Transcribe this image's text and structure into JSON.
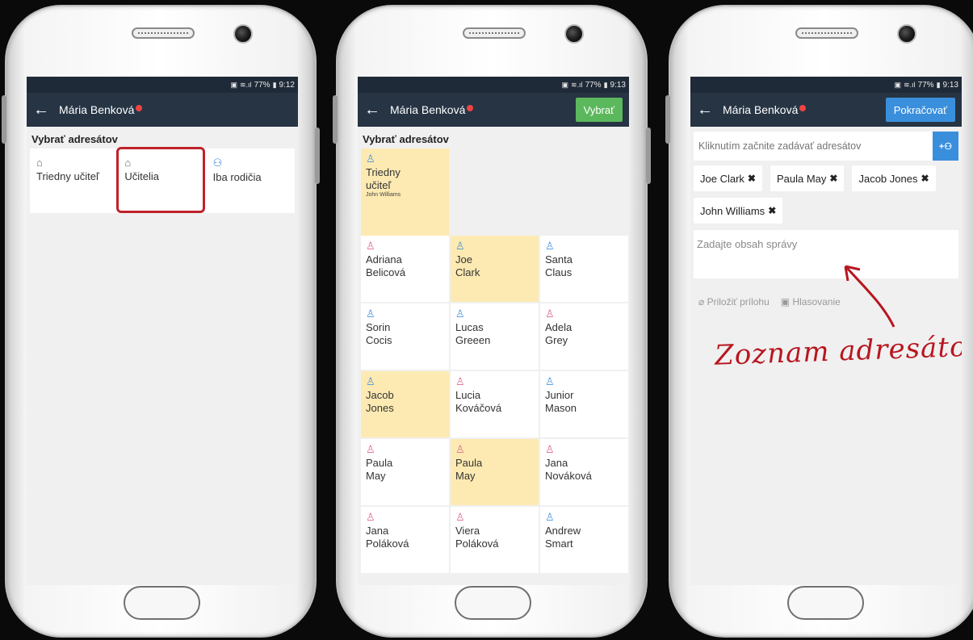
{
  "phone1": {
    "status": {
      "battery": "77%",
      "time": "9:12"
    },
    "header": {
      "title": "Mária Benková"
    },
    "section_title": "Vybrať adresátov",
    "groups": [
      {
        "label": "Triedny učiteľ",
        "icon": "school-icon"
      },
      {
        "label": "Učitelia",
        "icon": "school-icon"
      },
      {
        "label": "Iba rodičia",
        "icon": "parents-icon"
      }
    ]
  },
  "phone2": {
    "status": {
      "battery": "77%",
      "time": "9:13"
    },
    "header": {
      "title": "Mária Benková",
      "action": "Vybrať"
    },
    "section_title": "Vybrať adresátov",
    "first": {
      "line1": "Triedny",
      "line2": "učiteľ",
      "sub": "John Williams",
      "selected": true
    },
    "people": [
      {
        "first": "Adriana",
        "last": "Belicová",
        "gender": "female",
        "selected": false
      },
      {
        "first": "Joe",
        "last": "Clark",
        "gender": "male",
        "selected": true
      },
      {
        "first": "Santa",
        "last": "Claus",
        "gender": "male",
        "selected": false
      },
      {
        "first": "Sorin",
        "last": "Cocis",
        "gender": "male",
        "selected": false
      },
      {
        "first": "Lucas",
        "last": "Greeen",
        "gender": "male",
        "selected": false
      },
      {
        "first": "Adela",
        "last": "Grey",
        "gender": "female",
        "selected": false
      },
      {
        "first": "Jacob",
        "last": "Jones",
        "gender": "male",
        "selected": true
      },
      {
        "first": "Lucia",
        "last": "Kováčová",
        "gender": "female",
        "selected": false
      },
      {
        "first": "Junior",
        "last": "Mason",
        "gender": "male",
        "selected": false
      },
      {
        "first": "Paula",
        "last": "May",
        "gender": "female",
        "selected": false
      },
      {
        "first": "Paula",
        "last": "May",
        "gender": "female",
        "selected": true
      },
      {
        "first": "Jana",
        "last": "Nováková",
        "gender": "female",
        "selected": false
      },
      {
        "first": "Jana",
        "last": "Poláková",
        "gender": "female",
        "selected": false
      },
      {
        "first": "Viera",
        "last": "Poláková",
        "gender": "female",
        "selected": false
      },
      {
        "first": "Andrew",
        "last": "Smart",
        "gender": "male",
        "selected": false
      }
    ]
  },
  "phone3": {
    "status": {
      "battery": "77%",
      "time": "9:13"
    },
    "header": {
      "title": "Mária Benková",
      "action": "Pokračovať"
    },
    "recipient_placeholder": "Kliknutím začnite zadávať adresátov",
    "chips": [
      "Joe Clark",
      "Paula May",
      "Jacob Jones",
      "John Williams"
    ],
    "message_placeholder": "Zadajte obsah správy",
    "attach_label": "Priložiť prílohu",
    "poll_label": "Hlasovanie",
    "annotation": "Zoznam adresátov"
  },
  "colors": {
    "appbar": "#263444",
    "highlight": "#c0212b",
    "selected_cell": "#fdeab2",
    "green_btn": "#5cb85c",
    "blue_btn": "#3a8fdc"
  }
}
